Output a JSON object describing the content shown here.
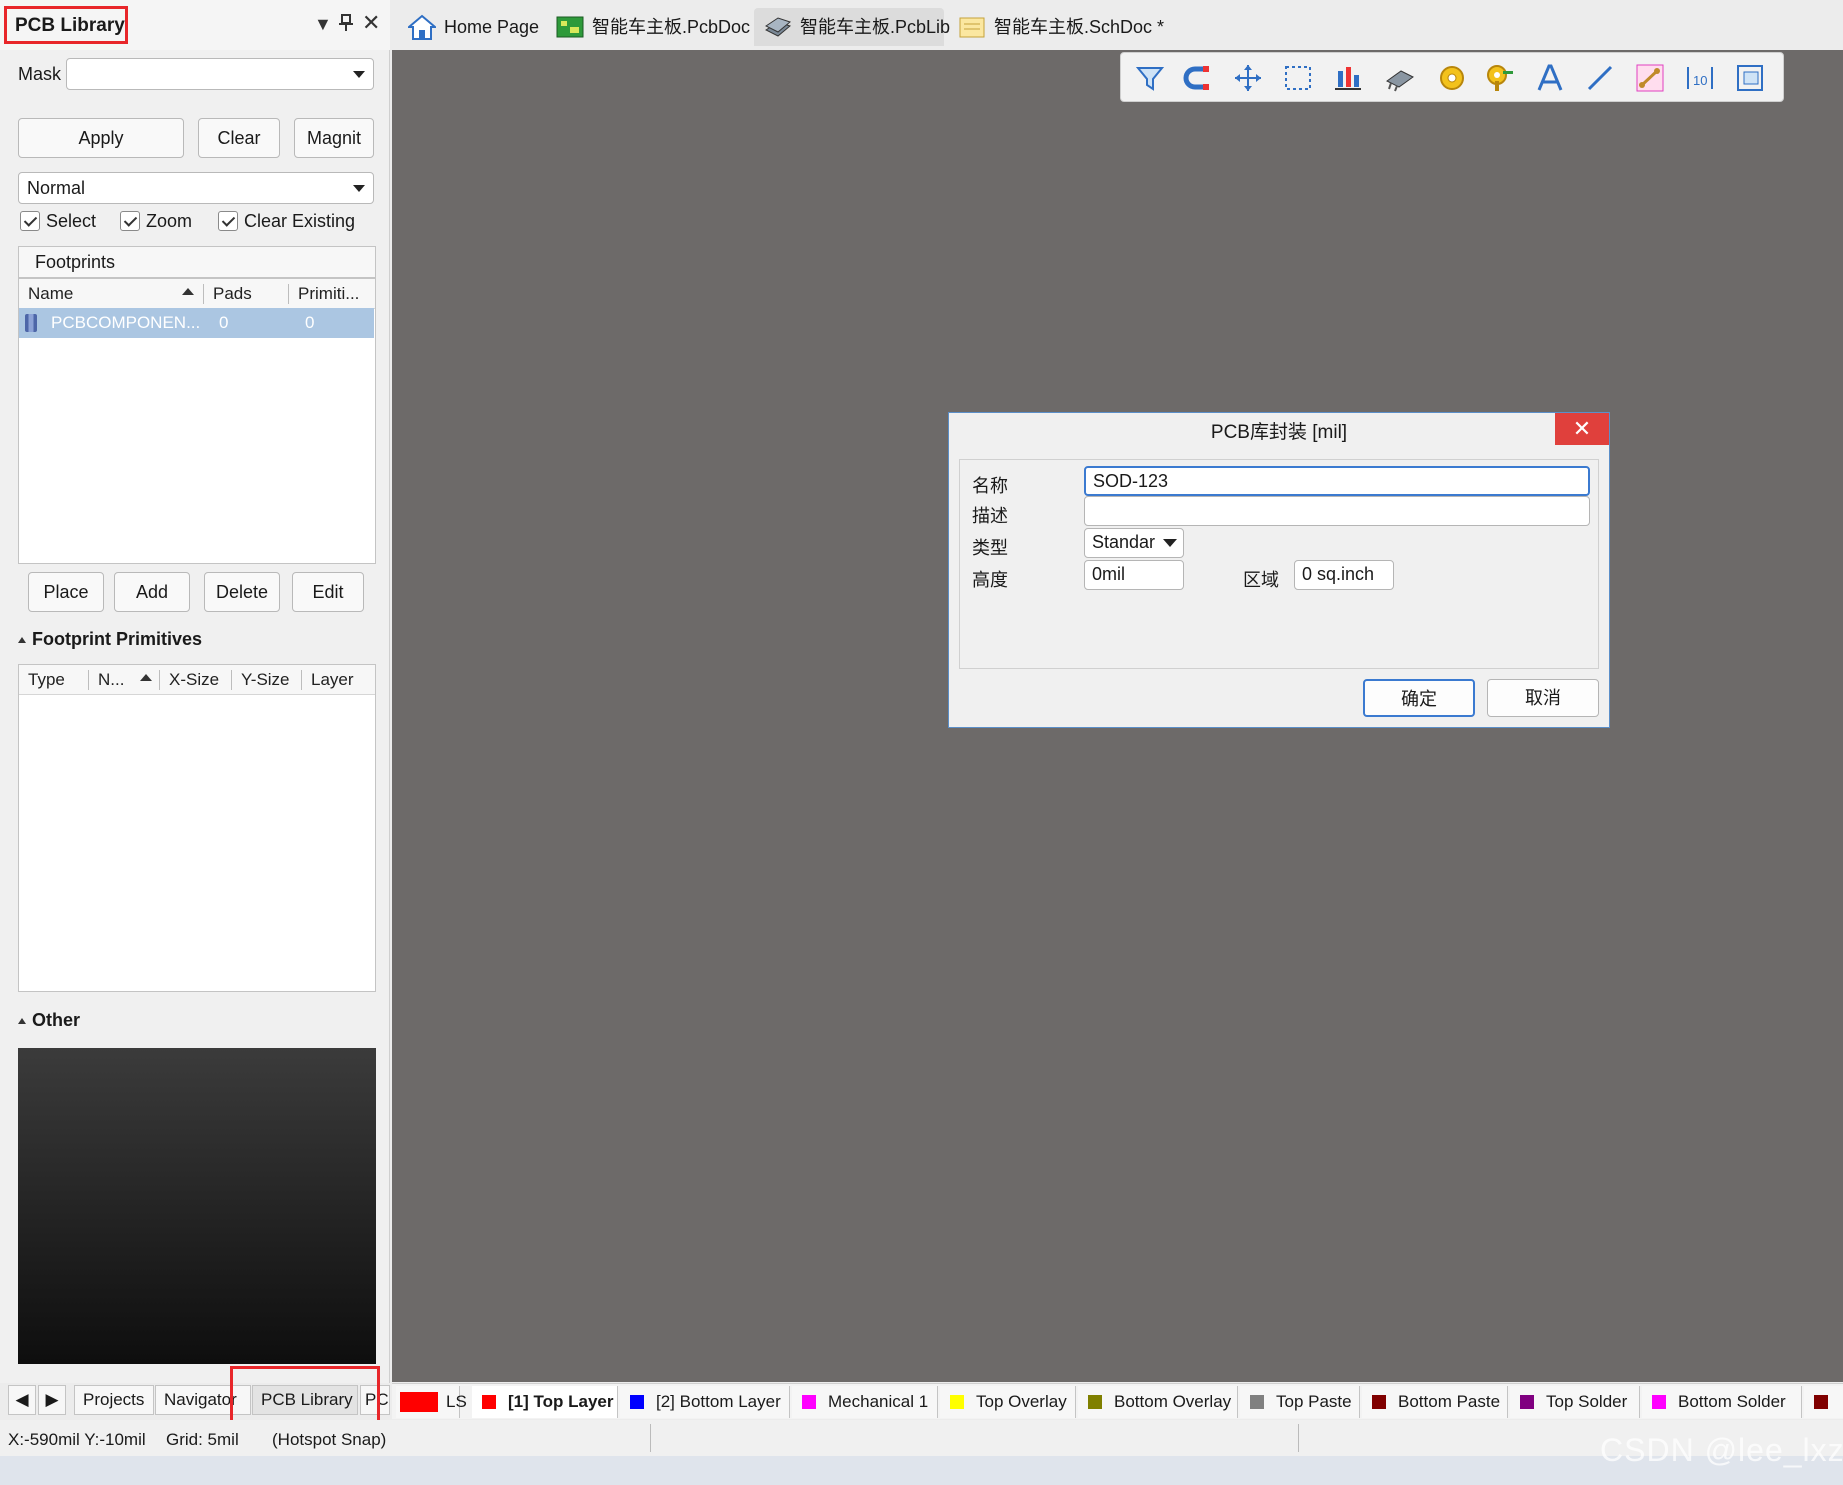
{
  "panel": {
    "title": "PCB Library",
    "mask_label": "Mask",
    "mask_value": "",
    "buttons": {
      "apply": "Apply",
      "clear": "Clear",
      "magnify": "Magnit"
    },
    "mode": "Normal",
    "checkboxes": {
      "select": "Select",
      "zoom": "Zoom",
      "clear_existing": "Clear Existing"
    },
    "footprints_header": "Footprints",
    "footprint_columns": {
      "name": "Name",
      "pads": "Pads",
      "primitives": "Primiti..."
    },
    "footprint_rows": [
      {
        "name": "PCBCOMPONEN...",
        "pads": "0",
        "primitives": "0"
      }
    ],
    "actions": {
      "place": "Place",
      "add": "Add",
      "delete": "Delete",
      "edit": "Edit"
    },
    "primitives_title": "Footprint Primitives",
    "primitive_columns": {
      "type": "Type",
      "name": "N...",
      "xsize": "X-Size",
      "ysize": "Y-Size",
      "layer": "Layer"
    },
    "other_title": "Other"
  },
  "panel_tabs": {
    "projects": "Projects",
    "navigator": "Navigator",
    "pcb_library": "PCB Library",
    "pc": "PC"
  },
  "doc_tabs": [
    {
      "label": "Home Page",
      "icon": "home-icon"
    },
    {
      "label": "智能车主板.PcbDoc *",
      "icon": "pcbdoc-icon"
    },
    {
      "label": "智能车主板.PcbLib",
      "icon": "pcblib-icon"
    },
    {
      "label": "智能车主板.SchDoc *",
      "icon": "schdoc-icon"
    }
  ],
  "toolbar_icons": [
    "filter-icon",
    "snap-magnet-icon",
    "move-icon",
    "select-rect-icon",
    "align-icon",
    "component-icon",
    "pad-icon",
    "via-icon",
    "text-icon",
    "line-icon",
    "route-icon",
    "dimension-icon",
    "region-icon"
  ],
  "dialog": {
    "title": "PCB库封装 [mil]",
    "close": "✕",
    "name_label": "名称",
    "name_value": "SOD-123",
    "desc_label": "描述",
    "desc_value": "",
    "type_label": "类型",
    "type_value": "Standar",
    "height_label": "高度",
    "height_value": "0mil",
    "area_label": "区域",
    "area_value": "0 sq.inch",
    "ok": "确定",
    "cancel": "取消"
  },
  "layer_tabs": [
    {
      "label": "LS",
      "color": "#ff0000"
    },
    {
      "label": "[1] Top Layer",
      "color": "#ff0000"
    },
    {
      "label": "[2] Bottom Layer",
      "color": "#0000ff"
    },
    {
      "label": "Mechanical 1",
      "color": "#ff00ff"
    },
    {
      "label": "Top Overlay",
      "color": "#ffff00"
    },
    {
      "label": "Bottom Overlay",
      "color": "#808000"
    },
    {
      "label": "Top Paste",
      "color": "#808080"
    },
    {
      "label": "Bottom Paste",
      "color": "#800000"
    },
    {
      "label": "Top Solder",
      "color": "#800080"
    },
    {
      "label": "Bottom Solder",
      "color": "#ff00ff"
    }
  ],
  "status": {
    "coords": "X:-590mil Y:-10mil",
    "grid": "Grid: 5mil",
    "snap": "(Hotspot Snap)"
  },
  "watermark": "CSDN @lee_lxz",
  "colors": {
    "canvas": "#6d6a69",
    "highlight": "#e8262a",
    "selection": "#abc6e2",
    "accent": "#3b7ad0"
  }
}
